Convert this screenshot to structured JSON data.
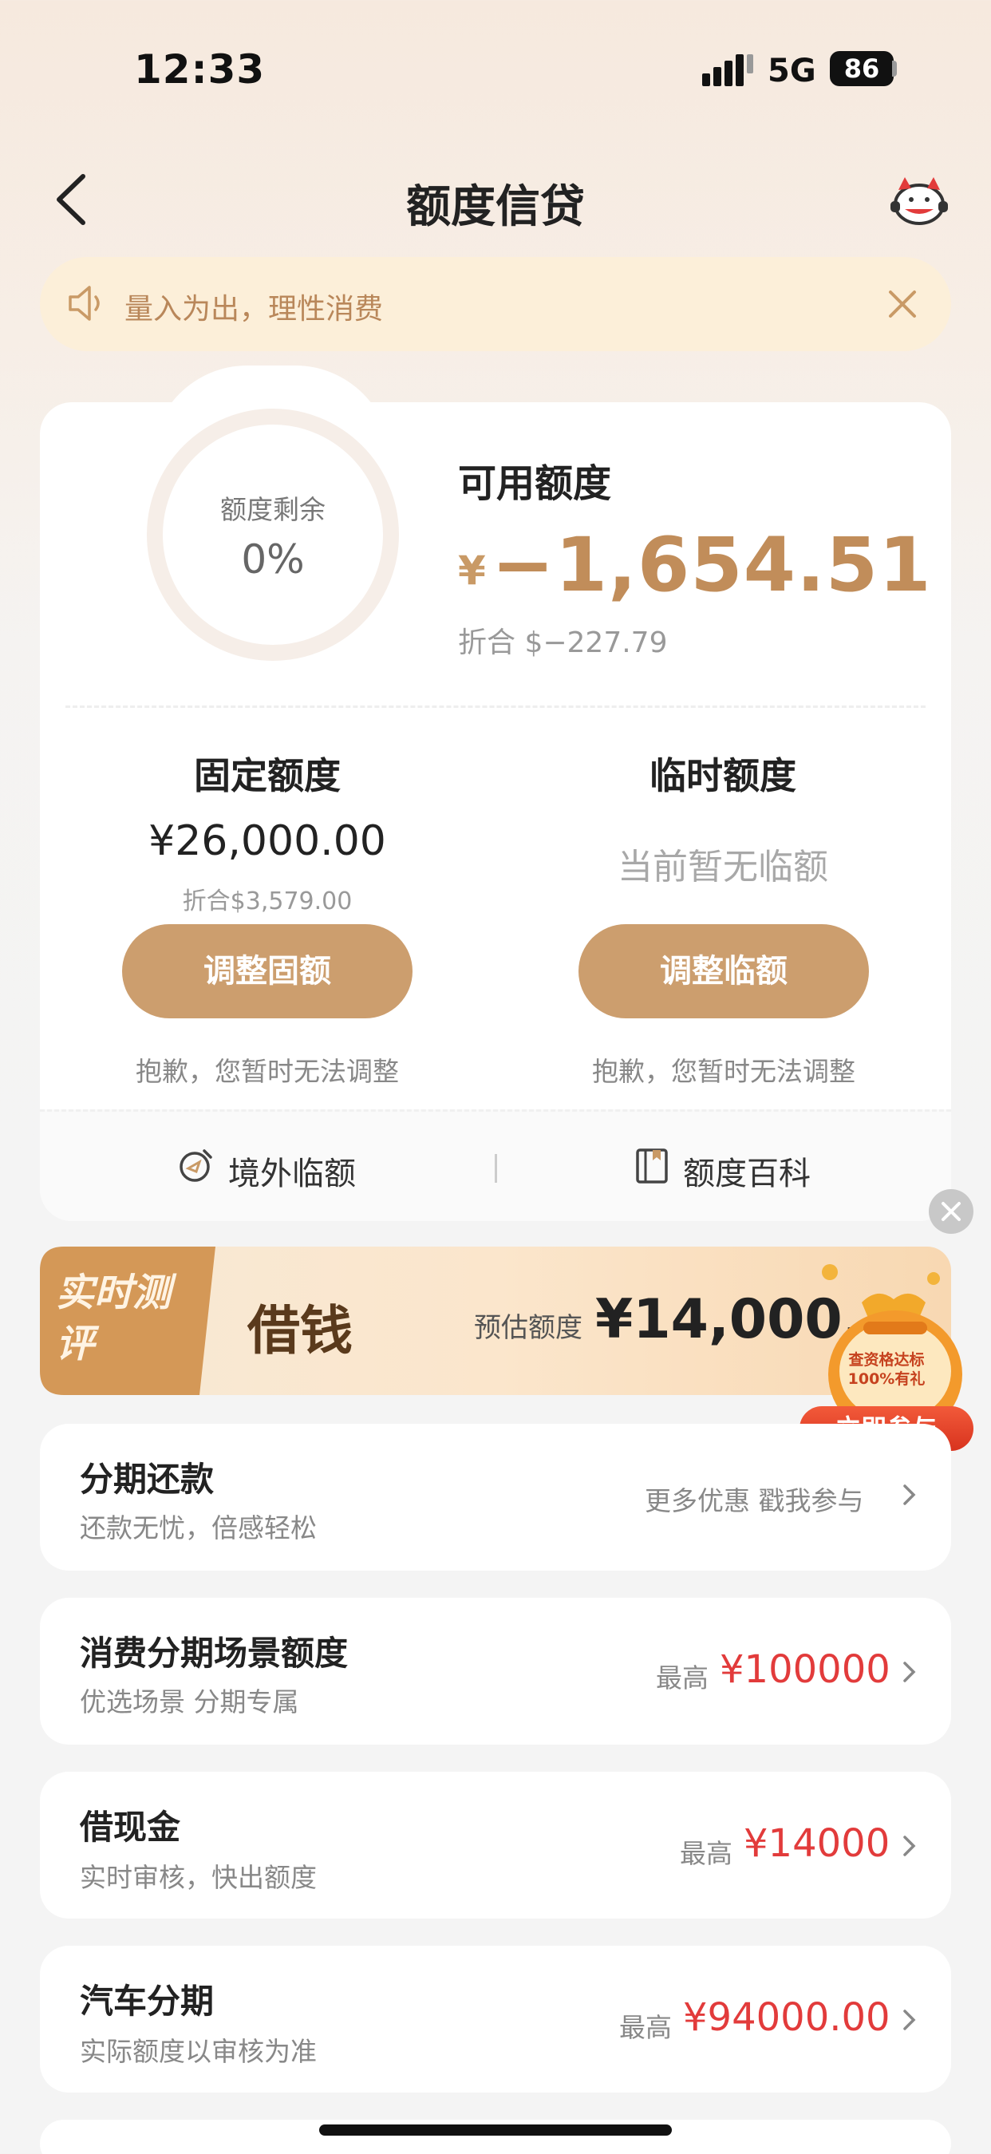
{
  "status_bar": {
    "time": "12:33",
    "network": "5G",
    "battery": "86"
  },
  "nav": {
    "title": "额度信贷"
  },
  "notice": {
    "text": "量入为出，理性消费"
  },
  "quota": {
    "ring_label": "额度剩余",
    "ring_percent": "0%",
    "available_label": "可用额度",
    "available_currency": "¥",
    "available_amount": "−1,654.51",
    "available_converted": "折合 $−227.79",
    "fixed": {
      "title": "固定额度",
      "amount": "¥26,000.00",
      "converted": "折合$3,579.00",
      "button": "调整固额",
      "note": "抱歉，您暂时无法调整"
    },
    "temporary": {
      "title": "临时额度",
      "status": "当前暂无临额",
      "button": "调整临额",
      "note": "抱歉，您暂时无法调整"
    },
    "links": {
      "overseas": "境外临额",
      "wiki": "额度百科"
    }
  },
  "banner": {
    "tag": "实时测评",
    "title": "借钱",
    "estimate_label": "预估额度",
    "estimate_amount": "¥14,000.00",
    "bag_text": "查资格达标100%有礼",
    "join_button": "立即参与"
  },
  "list": [
    {
      "title": "分期还款",
      "subtitle": "还款无忧，倍感轻松",
      "right_label": "更多优惠 戳我参与",
      "right_amount": ""
    },
    {
      "title": "消费分期场景额度",
      "subtitle": "优选场景 分期专属",
      "right_label": "最高",
      "right_amount": "¥100000"
    },
    {
      "title": "借现金",
      "subtitle": "实时审核，快出额度",
      "right_label": "最高",
      "right_amount": "¥14000"
    },
    {
      "title": "汽车分期",
      "subtitle": "实际额度以审核为准",
      "right_label": "最高",
      "right_amount": "¥94000.00"
    }
  ],
  "colors": {
    "accent": "#cc9e6e",
    "amount_gold": "#c18d5a",
    "price_red": "#e23b3b",
    "notice_bg": "#fcefd9"
  }
}
